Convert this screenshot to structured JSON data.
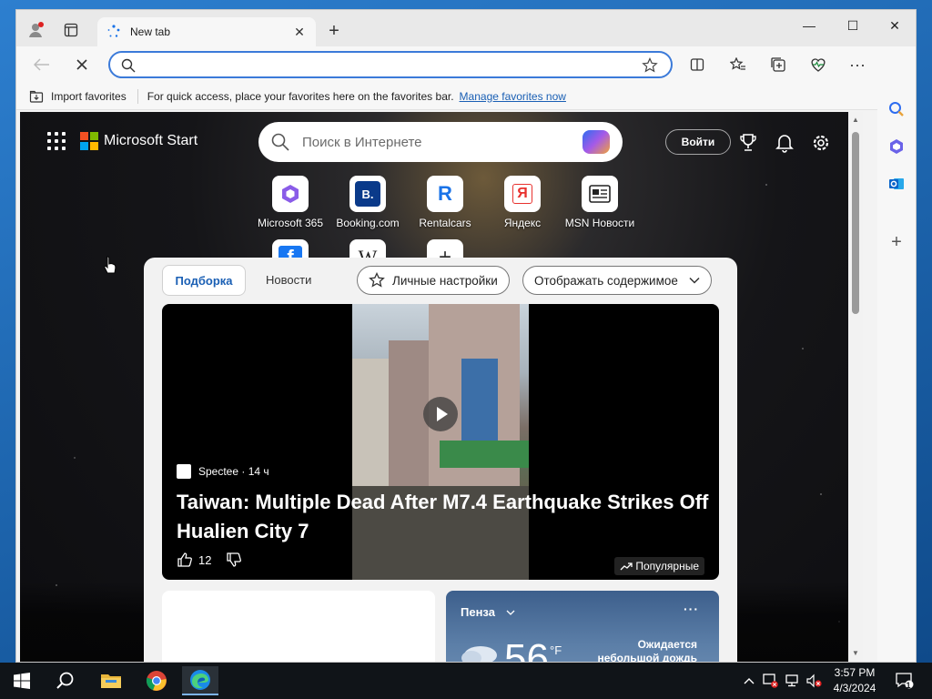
{
  "browser": {
    "tab_title": "New tab",
    "address_value": "",
    "address_placeholder": ""
  },
  "favorites_bar": {
    "import_label": "Import favorites",
    "message": "For quick access, place your favorites here on the favorites bar.",
    "manage_link": "Manage favorites now"
  },
  "ms_start": {
    "brand": "Microsoft Start",
    "search_placeholder": "Поиск в Интернете",
    "signin_label": "Войти"
  },
  "quick_links": [
    {
      "label": "Microsoft 365",
      "glyph": ""
    },
    {
      "label": "Booking.com",
      "glyph": "B."
    },
    {
      "label": "Rentalcars",
      "glyph": "R"
    },
    {
      "label": "Яндекс",
      "glyph": "Я"
    },
    {
      "label": "MSN Новости",
      "glyph": ""
    },
    {
      "label": "",
      "glyph": "f"
    },
    {
      "label": "",
      "glyph": "W"
    },
    {
      "label": "",
      "glyph": "+"
    }
  ],
  "feed": {
    "tab_active": "Подборка",
    "tab_news": "Новости",
    "personalize_label": "Личные настройки",
    "display_label": "Отображать содержимое"
  },
  "hero": {
    "source": "Spectee · 14 ч",
    "headline": "Taiwan: Multiple Dead After M7.4 Earthquake Strikes Off Hualien City 7",
    "likes": "12",
    "trend_label": "Популярные"
  },
  "weather": {
    "city": "Пенза",
    "temp": "56",
    "unit": "°F",
    "description": "Ожидается небольшой дождь в течение"
  },
  "taskbar": {
    "time": "3:57 PM",
    "date": "4/3/2024",
    "notification_count": "1"
  },
  "colors": {
    "accent": "#3b7ad9",
    "link": "#1a5fb4",
    "taskbar": "#101418"
  }
}
